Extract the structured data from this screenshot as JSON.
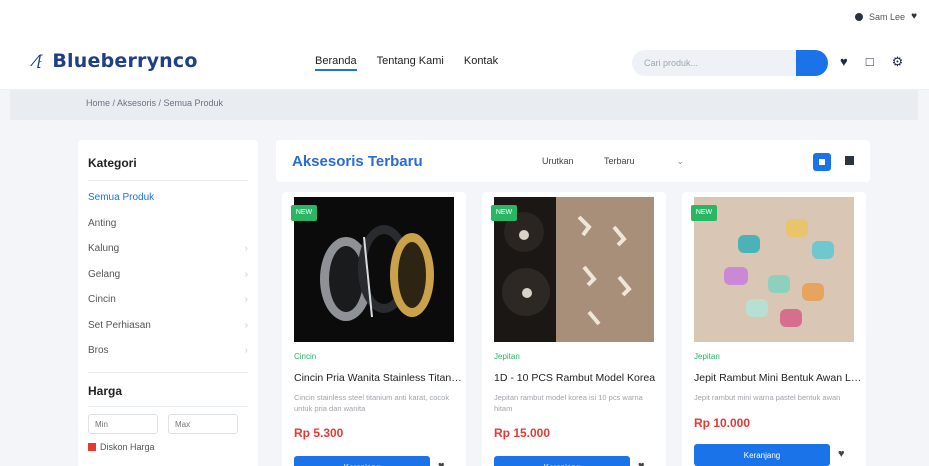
{
  "topbar": {
    "account_label": "Sam Lee"
  },
  "brand": {
    "name": "Blueberrynco"
  },
  "nav": {
    "links": [
      "Beranda",
      "Tentang Kami",
      "Kontak"
    ]
  },
  "search": {
    "placeholder": "Cari produk..."
  },
  "breadcrumb": "Home / Aksesoris / Semua Produk",
  "sidebar": {
    "category_title": "Kategori",
    "categories": [
      "Semua Produk",
      "Anting",
      "Kalung",
      "Gelang",
      "Cincin",
      "Set Perhiasan",
      "Bros"
    ],
    "price_title": "Harga",
    "price_min_placeholder": "Min",
    "price_max_placeholder": "Max",
    "filter_label": "Diskon Harga"
  },
  "content": {
    "title": "Aksesoris Terbaru",
    "sort_label": "Urutkan",
    "sort_value": "Terbaru"
  },
  "products": [
    {
      "badge": "NEW",
      "category": "Cincin",
      "name": "Cincin Pria Wanita Stainless Titanium",
      "desc": "Cincin stainless steel titanium anti karat, cocok untuk pria dan wanita",
      "price": "Rp 5.300",
      "button": "Keranjang"
    },
    {
      "badge": "NEW",
      "category": "Jepitan",
      "name": "1D - 10 PCS Rambut Model Korea",
      "desc": "Jepitan rambut model korea isi 10 pcs warna hitam",
      "price": "Rp 15.000",
      "button": "Keranjang"
    },
    {
      "badge": "NEW",
      "category": "Jepitan",
      "name": "Jepit Rambut Mini Bentuk Awan Lucu",
      "desc": "Jepit rambut mini warna pastel bentuk awan",
      "price": "Rp 10.000",
      "button": "Keranjang"
    }
  ]
}
